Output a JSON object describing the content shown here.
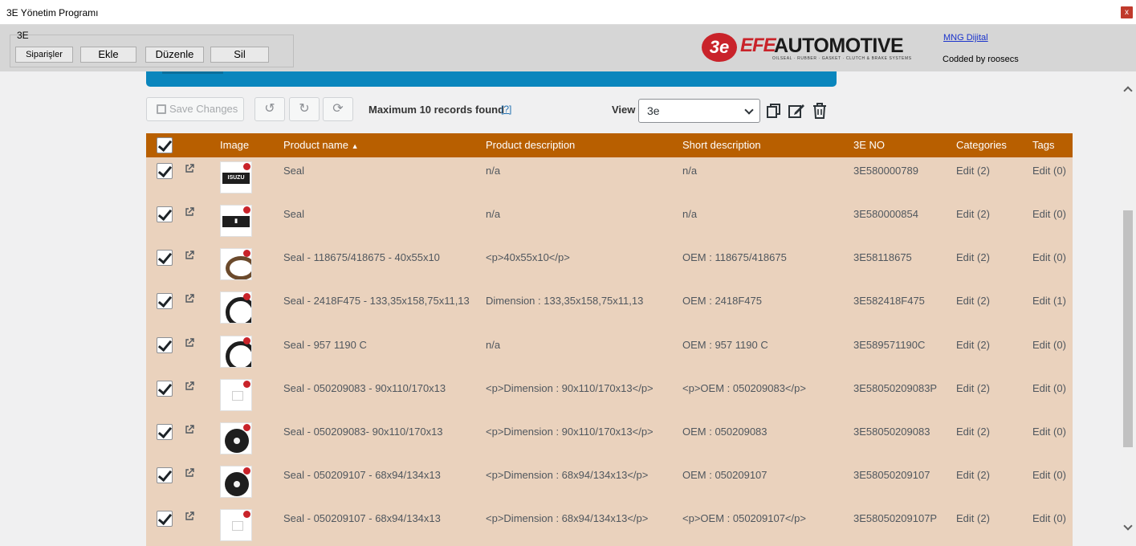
{
  "window": {
    "title": "3E Yönetim Programı",
    "close_label": "x"
  },
  "toolbar": {
    "group_label": "3E",
    "buttons": [
      "Siparişler",
      "Ekle",
      "Düzenle",
      "Sil"
    ],
    "logo": {
      "mark": "3e",
      "efe": "EFE",
      "automotive": "AUTOMOTIVE",
      "tagline": "OILSEAL · RUBBER · GASKET · CLUTCH & BRAKE SYSTEMS"
    },
    "link": "MNG Dijital",
    "credit": "Codded by roosecs"
  },
  "actions": {
    "save_label": "Save Changes",
    "records_text": "Maximum 10 records found",
    "help_text": "[?]",
    "view_label": "View",
    "view_value": "3e"
  },
  "table": {
    "headers": {
      "image": "Image",
      "product_name": "Product name",
      "product_description": "Product description",
      "short_description": "Short description",
      "e3_no": "3E NO",
      "categories": "Categories",
      "tags": "Tags"
    },
    "rows": [
      {
        "name": "Seal",
        "desc": "n/a",
        "short": "n/a",
        "no": "3E580000789",
        "categories": "Edit (2)",
        "tags": "Edit (0)",
        "thumb": "isuzu"
      },
      {
        "name": "Seal",
        "desc": "n/a",
        "short": "n/a",
        "no": "3E580000854",
        "categories": "Edit (2)",
        "tags": "Edit (0)",
        "thumb": "brand"
      },
      {
        "name": "Seal - 118675/418675 - 40x55x10",
        "desc": "<p>40x55x10</p>",
        "short": "OEM : 118675/418675",
        "no": "3E58118675",
        "categories": "Edit (2)",
        "tags": "Edit (0)",
        "thumb": "ring-brown"
      },
      {
        "name": "Seal - 2418F475 - 133,35x158,75x11,13",
        "desc": "Dimension : 133,35x158,75x11,13",
        "short": "OEM : 2418F475",
        "no": "3E582418F475",
        "categories": "Edit (2)",
        "tags": "Edit (1)",
        "thumb": "ring"
      },
      {
        "name": "Seal - 957 1190 C",
        "desc": "n/a",
        "short": "OEM : 957 1190 C",
        "no": "3E589571190C",
        "categories": "Edit (2)",
        "tags": "Edit (0)",
        "thumb": "ring"
      },
      {
        "name": "Seal - 050209083 - 90x110/170x13",
        "desc": "<p>Dimension : 90x110/170x13</p>",
        "short": "<p>OEM : 050209083</p>",
        "no": "3E58050209083P",
        "categories": "Edit (2)",
        "tags": "Edit (0)",
        "thumb": "placeholder"
      },
      {
        "name": "Seal - 050209083- 90x110/170x13",
        "desc": "<p>Dimension : 90x110/170x13</p>",
        "short": "OEM : 050209083",
        "no": "3E58050209083",
        "categories": "Edit (2)",
        "tags": "Edit (0)",
        "thumb": "disc"
      },
      {
        "name": "Seal - 050209107 - 68x94/134x13",
        "desc": "<p>Dimension : 68x94/134x13</p>",
        "short": "OEM : 050209107",
        "no": "3E58050209107",
        "categories": "Edit (2)",
        "tags": "Edit (0)",
        "thumb": "disc"
      },
      {
        "name": "Seal - 050209107 - 68x94/134x13",
        "desc": "<p>Dimension : 68x94/134x13</p>",
        "short": "<p>OEM : 050209107</p>",
        "no": "3E58050209107P",
        "categories": "Edit (2)",
        "tags": "Edit (0)",
        "thumb": "placeholder"
      }
    ]
  },
  "colors": {
    "header_bg": "#b85f00",
    "table_bg": "#ead2bd",
    "banner": "#0a86bd"
  }
}
